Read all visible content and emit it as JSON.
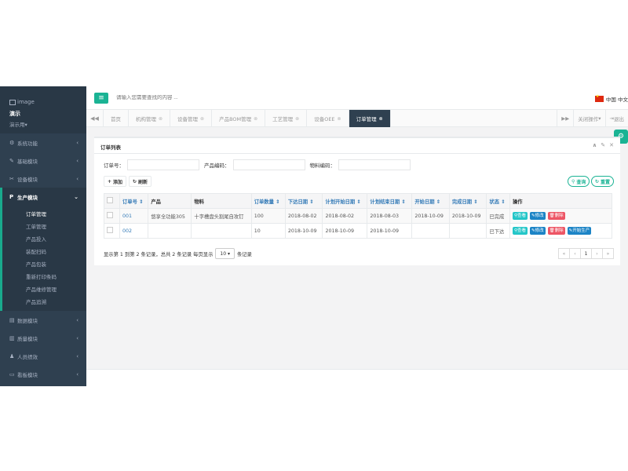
{
  "profile": {
    "image_alt": "image",
    "name": "演示",
    "role": "演示用",
    "role_caret": "▾"
  },
  "sidebar": {
    "items": [
      {
        "icon": "gear-icon",
        "glyph": "⚙",
        "label": "系统功能"
      },
      {
        "icon": "wrench-icon",
        "glyph": "✎",
        "label": "基础模块"
      },
      {
        "icon": "tools-icon",
        "glyph": "✂",
        "label": "设备模块"
      },
      {
        "icon": "p-icon",
        "glyph": "P",
        "label": "生产模块"
      },
      {
        "icon": "file-icon",
        "glyph": "▤",
        "label": "数据模块"
      },
      {
        "icon": "chart-icon",
        "glyph": "▥",
        "label": "质量模块"
      },
      {
        "icon": "user-icon",
        "glyph": "♟",
        "label": "人员绩效"
      },
      {
        "icon": "monitor-icon",
        "glyph": "▭",
        "label": "看板模块"
      }
    ],
    "sub_items": [
      "订单管理",
      "工单管理",
      "产品投入",
      "装配扫码",
      "产品包装",
      "重新打印条码",
      "产品维修管理",
      "产品追溯"
    ]
  },
  "topbar": {
    "menu_glyph": "≡",
    "search_placeholder": "请输入您需要查找的内容 ...",
    "lang": "中国 中文"
  },
  "tabs": {
    "left_arrow": "◀◀",
    "items": [
      {
        "label": "首页",
        "close": ""
      },
      {
        "label": "机构管理",
        "close": "⊗"
      },
      {
        "label": "设备管理",
        "close": "⊗"
      },
      {
        "label": "产品BOM管理",
        "close": "⊗"
      },
      {
        "label": "工艺管理",
        "close": "⊗"
      },
      {
        "label": "设备OEE",
        "close": "⊗"
      },
      {
        "label": "订单管理",
        "close": "⊗"
      }
    ],
    "right_arrow": "▶▶",
    "close_ops": "关闭操作",
    "close_ops_caret": "▾",
    "logout": "退出",
    "logout_glyph": "⇥"
  },
  "panel": {
    "title": "订单列表",
    "tools": {
      "collapse": "∧",
      "config": "✎",
      "close": "✕"
    },
    "filters": [
      {
        "label": "订单号：",
        "value": ""
      },
      {
        "label": "产品编码：",
        "value": ""
      },
      {
        "label": "物料编码：",
        "value": ""
      }
    ],
    "buttons": {
      "add": "添加",
      "add_glyph": "+",
      "refresh": "刷新",
      "refresh_glyph": "↻",
      "search": "查询",
      "search_glyph": "⚲",
      "reset": "重置",
      "reset_glyph": "↻"
    }
  },
  "table": {
    "headers": [
      "订单号 ⇕",
      "产品",
      "物料",
      "订单数量 ⇕",
      "下达日期 ⇕",
      "计划开始日期 ⇕",
      "计划结束日期 ⇕",
      "开始日期 ⇕",
      "完成日期 ⇕",
      "状态 ⇕",
      "操作"
    ],
    "rows": [
      {
        "order_no": "001",
        "product": "悠享全功能305",
        "material": "十字槽盘头割尾自攻钉",
        "qty": "100",
        "issue_date": "2018-08-02",
        "plan_start": "2018-08-02",
        "plan_end": "2018-08-03",
        "start_date": "2018-10-09",
        "finish_date": "2018-10-09",
        "status": "已完成",
        "ops": {
          "view": "⚲查看",
          "edit": "✎修改",
          "del": "🗑删除",
          "start": ""
        }
      },
      {
        "order_no": "002",
        "product": "",
        "material": "",
        "qty": "10",
        "issue_date": "2018-10-09",
        "plan_start": "2018-10-09",
        "plan_end": "2018-10-09",
        "start_date": "",
        "finish_date": "",
        "status": "已下达",
        "ops": {
          "view": "⚲查看",
          "edit": "✎修改",
          "del": "🗑删除",
          "start": "✎开始生产"
        }
      }
    ]
  },
  "pagination": {
    "info": "显示第 1 到第 2 条记录，总共 2 条记录 每页显示",
    "page_size": "10",
    "page_size_caret": "▾",
    "suffix": "条记录",
    "first": "«",
    "prev": "‹",
    "current": "1",
    "next": "›",
    "last": "»"
  },
  "fab": {
    "glyph": "⚙"
  }
}
